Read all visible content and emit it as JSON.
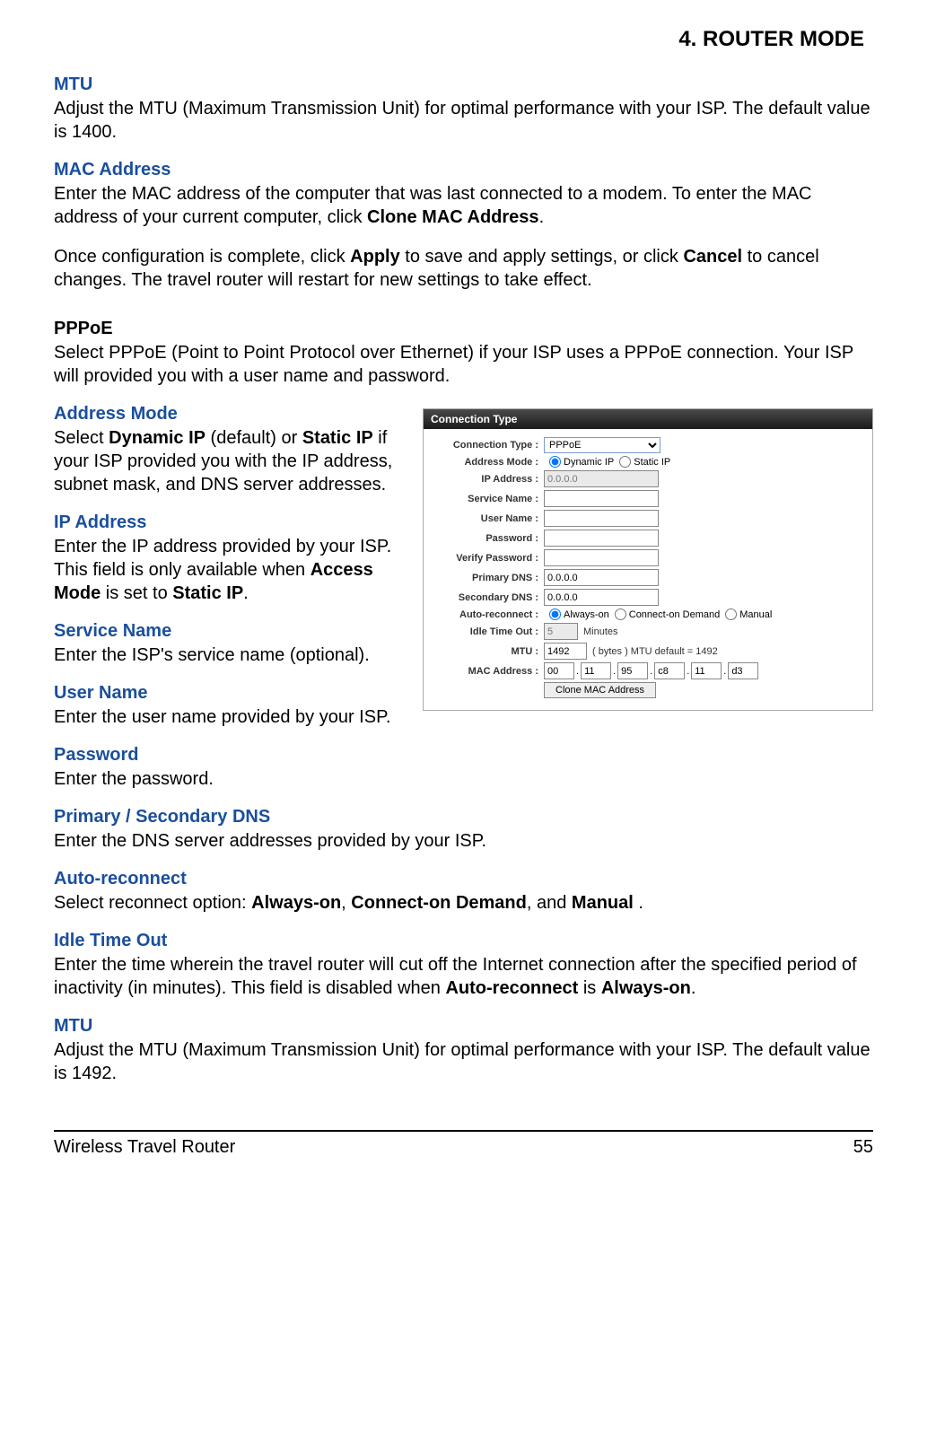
{
  "chapter": "4.  ROUTER MODE",
  "sections": {
    "mtu1": {
      "title": "MTU",
      "body": "Adjust the MTU (Maximum Transmission Unit) for optimal performance with your ISP. The default value is 1400."
    },
    "mac_address": {
      "title": "MAC Address",
      "body_p1_a": "Enter the MAC address of the computer that was last connected to a modem. To enter the MAC address of your current computer, click ",
      "body_p1_b": "Clone MAC Address",
      "body_p1_c": ".",
      "body_p2_a": "Once configuration is complete, click ",
      "body_p2_b": "Apply",
      "body_p2_c": " to save and apply settings, or click ",
      "body_p2_d": "Cancel",
      "body_p2_e": " to cancel changes. The travel router will restart for new settings to take effect."
    },
    "pppoe": {
      "title": "PPPoE",
      "body": "Select PPPoE (Point to Point Protocol over Ethernet) if your ISP uses a PPPoE connection. Your ISP will provided you with a user name and password."
    },
    "address_mode": {
      "title": "Address Mode",
      "a": "Select ",
      "b": "Dynamic IP",
      "c": " (default) or ",
      "d": "Static IP",
      "e": " if your ISP provided you with the IP address, subnet mask, and DNS server addresses."
    },
    "ip_address": {
      "title": "IP Address",
      "a": "Enter the IP address provided by your ISP. This field is only available when ",
      "b": "Access Mode",
      "c": " is set to ",
      "d": "Static IP",
      "e": "."
    },
    "service_name": {
      "title": "Service Name",
      "body": "Enter the ISP's service name (optional)."
    },
    "user_name": {
      "title": "User Name",
      "body": "Enter the user name provided by your ISP."
    },
    "password": {
      "title": "Password",
      "body": "Enter the password."
    },
    "dns": {
      "title": "Primary / Secondary DNS",
      "body": "Enter the DNS server addresses provided by your ISP."
    },
    "auto_reconnect": {
      "title": "Auto-reconnect",
      "a": "Select reconnect option: ",
      "b": "Always-on",
      "c": ", ",
      "d": "Connect-on Demand",
      "e": ", and ",
      "f": "Manual",
      "g": " ."
    },
    "idle": {
      "title": "Idle Time Out",
      "a": "Enter the time wherein the travel router will cut off the Internet connection after the specified period of inactivity (in minutes). This field is disabled when ",
      "b": "Auto-reconnect",
      "c": " is ",
      "d": "Always-on",
      "e": "."
    },
    "mtu2": {
      "title": "MTU",
      "body": "Adjust the MTU (Maximum Transmission Unit) for optimal performance with your ISP. The default value is 1492."
    }
  },
  "ui": {
    "panel_title": "Connection Type",
    "labels": {
      "connection_type": "Connection Type :",
      "address_mode": "Address Mode :",
      "ip_address": "IP Address :",
      "service_name": "Service Name :",
      "user_name": "User Name :",
      "password": "Password :",
      "verify_password": "Verify Password :",
      "primary_dns": "Primary DNS :",
      "secondary_dns": "Secondary DNS :",
      "auto_reconnect": "Auto-reconnect :",
      "idle_timeout": "Idle Time Out :",
      "mtu": "MTU :",
      "mac_address": "MAC Address :"
    },
    "values": {
      "connection_type": "PPPoE",
      "mode_dynamic": "Dynamic IP",
      "mode_static": "Static IP",
      "ip_address": "0.0.0.0",
      "primary_dns": "0.0.0.0",
      "secondary_dns": "0.0.0.0",
      "rc_always": "Always-on",
      "rc_demand": "Connect-on Demand",
      "rc_manual": "Manual",
      "idle_value": "5",
      "idle_unit": "Minutes",
      "mtu_value": "1492",
      "mtu_hint": "( bytes ) MTU default = 1492",
      "mac": [
        "00",
        "11",
        "95",
        "c8",
        "11",
        "d3"
      ],
      "clone_btn": "Clone MAC Address"
    }
  },
  "footer": {
    "product": "Wireless Travel Router",
    "page": "55"
  }
}
